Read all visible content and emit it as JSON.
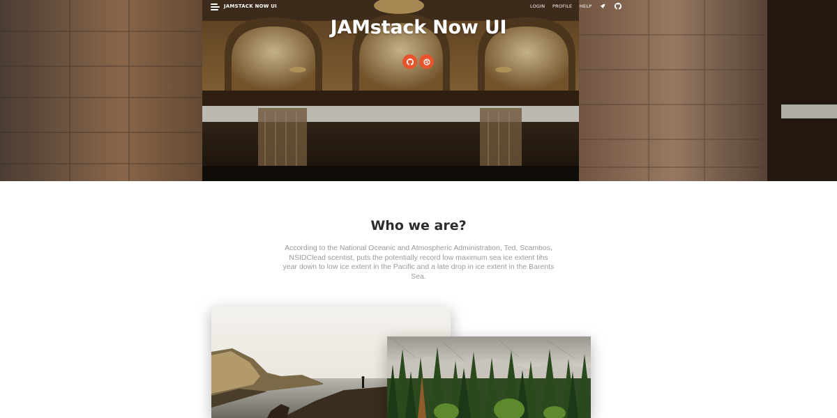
{
  "navbar": {
    "brand": "JAMSTACK NOW UI",
    "links": [
      "LOGIN",
      "PROFILE",
      "HELP"
    ],
    "icons": [
      "menu-icon",
      "rocket-icon",
      "github-icon"
    ]
  },
  "hero": {
    "title": "JAMstack Now UI",
    "buttons": [
      "github-icon",
      "dribbble-icon"
    ],
    "accent_color": "#e8552c"
  },
  "about": {
    "title": "Who we are?",
    "text": "According to the National Oceanic and Atmospheric Administration, Ted, Scambos, NSIDClead scentist, puts the potentially record low maximum sea ice extent tihs year down to low ice extent in the Pacific and a late drop in ice extent in the Barents Sea."
  },
  "images": [
    "coastal-cliff-photo",
    "pine-forest-photo"
  ]
}
